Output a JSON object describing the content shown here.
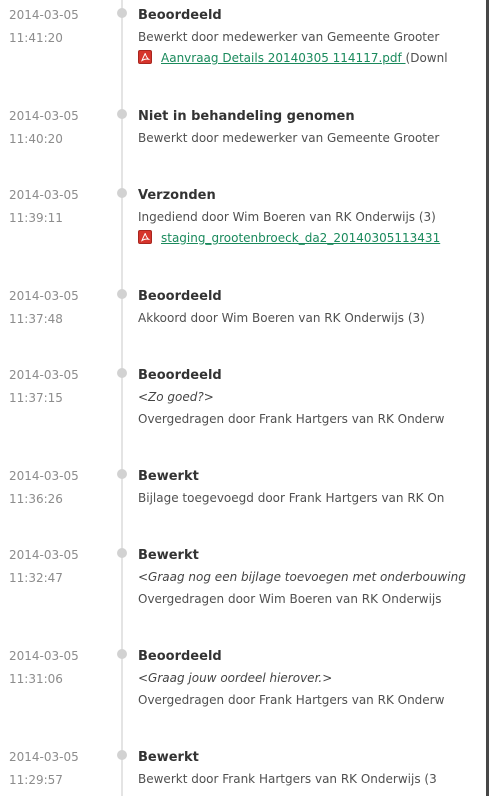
{
  "events": [
    {
      "date": "2014-03-05",
      "time": "11:41:20",
      "status": "Beoordeeld",
      "lines": [
        {
          "text": "Bewerkt door medewerker van Gemeente Grooter",
          "italic": false
        }
      ],
      "attachment": {
        "link": "Aanvraag Details 20140305 114117.pdf ",
        "suffix": "(Downl"
      }
    },
    {
      "date": "2014-03-05",
      "time": "11:40:20",
      "status": "Niet in behandeling genomen",
      "lines": [
        {
          "text": "Bewerkt door medewerker van Gemeente Grooter",
          "italic": false
        }
      ]
    },
    {
      "date": "2014-03-05",
      "time": "11:39:11",
      "status": "Verzonden",
      "lines": [
        {
          "text": "Ingediend door Wim Boeren van RK Onderwijs (3)",
          "italic": false
        }
      ],
      "attachment": {
        "link": "staging_grootenbroeck_da2_20140305113431",
        "suffix": ""
      }
    },
    {
      "date": "2014-03-05",
      "time": "11:37:48",
      "status": "Beoordeeld",
      "lines": [
        {
          "text": "Akkoord door Wim Boeren van RK Onderwijs (3)",
          "italic": false
        }
      ]
    },
    {
      "date": "2014-03-05",
      "time": "11:37:15",
      "status": "Beoordeeld",
      "lines": [
        {
          "text": "<Zo goed?>",
          "italic": true
        },
        {
          "text": "Overgedragen door Frank Hartgers van RK Onderw",
          "italic": false
        }
      ]
    },
    {
      "date": "2014-03-05",
      "time": "11:36:26",
      "status": "Bewerkt",
      "lines": [
        {
          "text": "Bijlage toegevoegd door Frank Hartgers van RK On",
          "italic": false
        }
      ]
    },
    {
      "date": "2014-03-05",
      "time": "11:32:47",
      "status": "Bewerkt",
      "lines": [
        {
          "text": "<Graag nog een bijlage toevoegen met onderbouwing",
          "italic": true
        },
        {
          "text": "Overgedragen door Wim Boeren van RK Onderwijs",
          "italic": false
        }
      ]
    },
    {
      "date": "2014-03-05",
      "time": "11:31:06",
      "status": "Beoordeeld",
      "lines": [
        {
          "text": "<Graag jouw oordeel hierover.>",
          "italic": true
        },
        {
          "text": "Overgedragen door Frank Hartgers van RK Onderw",
          "italic": false
        }
      ]
    },
    {
      "date": "2014-03-05",
      "time": "11:29:57",
      "status": "Bewerkt",
      "lines": [
        {
          "text": "Bewerkt door Frank Hartgers van RK Onderwijs (3",
          "italic": false
        }
      ]
    }
  ],
  "icons": {
    "attachment": "pdf-icon",
    "timeline_marker": "dot"
  },
  "colors": {
    "link": "#1a8a5c",
    "pdf": "#d6342c",
    "timeline": "#e4e4e4",
    "marker": "#d2d2d2"
  }
}
